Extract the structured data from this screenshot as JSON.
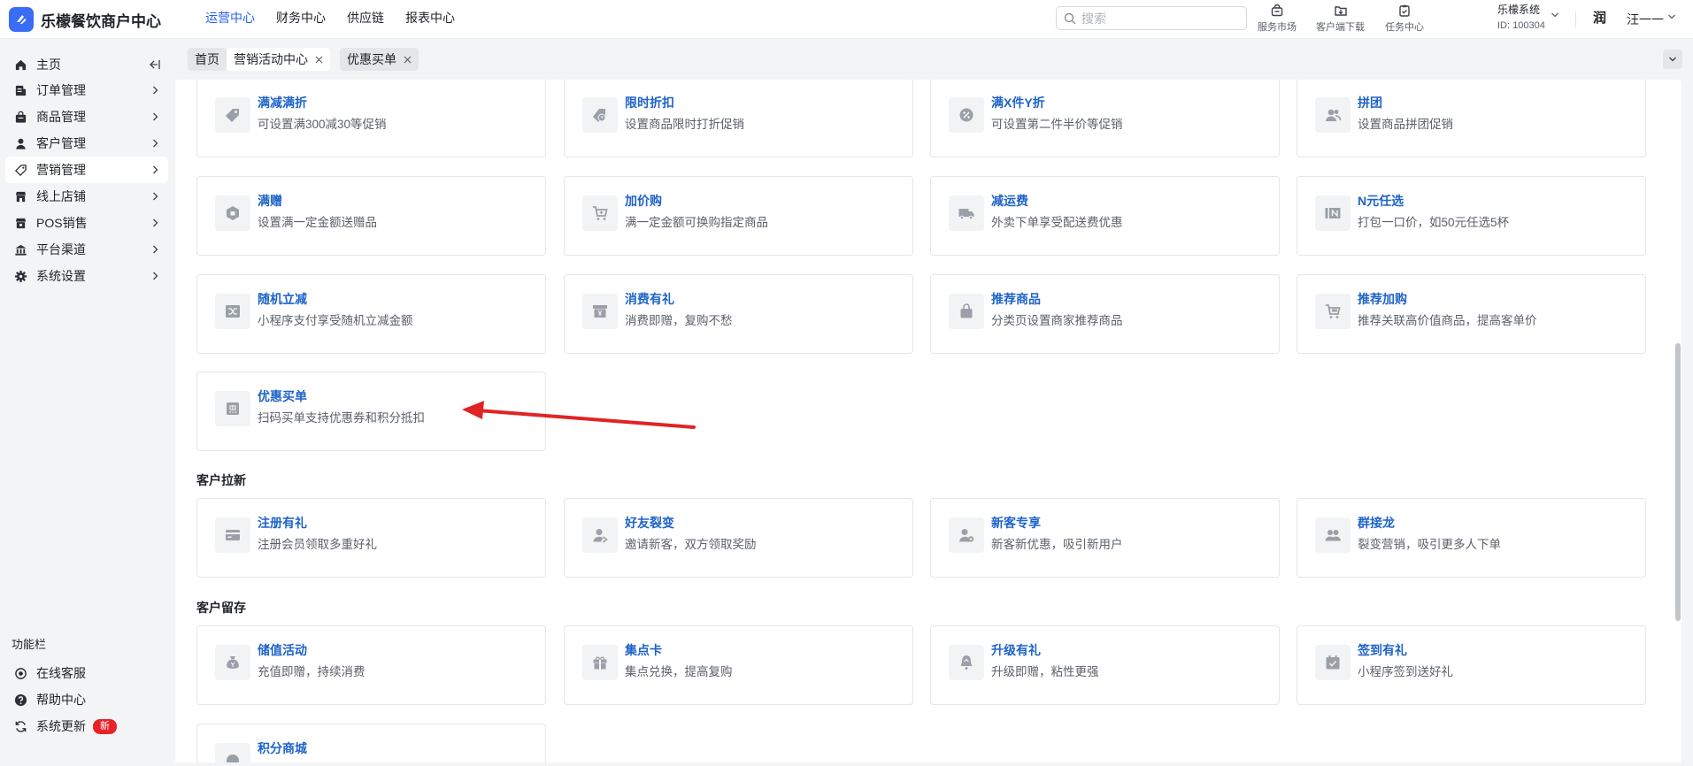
{
  "header": {
    "brand": "乐檬餐饮商户中心",
    "nav": [
      "运营中心",
      "财务中心",
      "供应链",
      "报表中心"
    ],
    "active_nav": 0,
    "search_placeholder": "搜索",
    "tools": [
      {
        "label": "服务市场",
        "icon": "store-icon"
      },
      {
        "label": "客户端下载",
        "icon": "download-folder-icon"
      },
      {
        "label": "任务中心",
        "icon": "clipboard-icon"
      }
    ],
    "system_name": "乐檬系统",
    "system_id": "ID: 100304",
    "avatar_text": "润",
    "user_name": "汪一一"
  },
  "sidebar": {
    "items": [
      {
        "label": "主页",
        "icon": "home-icon"
      },
      {
        "label": "订单管理",
        "icon": "order-icon"
      },
      {
        "label": "商品管理",
        "icon": "bag-icon"
      },
      {
        "label": "客户管理",
        "icon": "user-icon"
      },
      {
        "label": "营销管理",
        "icon": "tag-icon"
      },
      {
        "label": "线上店铺",
        "icon": "shop-icon"
      },
      {
        "label": "POS销售",
        "icon": "pos-icon"
      },
      {
        "label": "平台渠道",
        "icon": "bank-icon"
      },
      {
        "label": "系统设置",
        "icon": "gear-icon"
      }
    ],
    "active_index": 4,
    "section_label": "功能栏",
    "footer": [
      {
        "label": "在线客服",
        "icon": "headset-icon"
      },
      {
        "label": "帮助中心",
        "icon": "help-icon"
      },
      {
        "label": "系统更新",
        "icon": "refresh-icon",
        "badge": "新"
      }
    ]
  },
  "tabs": [
    {
      "label": "首页",
      "closable": false
    },
    {
      "label": "营销活动中心",
      "closable": true,
      "active": true
    },
    {
      "label": "优惠买单",
      "closable": true
    }
  ],
  "sections": [
    {
      "title": "",
      "cards": [
        {
          "title": "满减满折",
          "desc": "可设置满300减30等促销",
          "icon": "tag-icon"
        },
        {
          "title": "限时折扣",
          "desc": "设置商品限时打折促销",
          "icon": "clock-tag-icon"
        },
        {
          "title": "满X件Y折",
          "desc": "可设置第二件半价等促销",
          "icon": "percent-icon"
        },
        {
          "title": "拼团",
          "desc": "设置商品拼团促销",
          "icon": "group-icon"
        },
        {
          "title": "满赠",
          "desc": "设置满一定金额送赠品",
          "icon": "gift-box-icon"
        },
        {
          "title": "加价购",
          "desc": "满一定金额可换购指定商品",
          "icon": "cart-plus-icon"
        },
        {
          "title": "减运费",
          "desc": "外卖下单享受配送费优惠",
          "icon": "truck-icon"
        },
        {
          "title": "N元任选",
          "desc": "打包一口价，如50元任选5杯",
          "icon": "n-icon"
        },
        {
          "title": "随机立减",
          "desc": "小程序支付享受随机立减金额",
          "icon": "shuffle-icon"
        },
        {
          "title": "消费有礼",
          "desc": "消费即赠，复购不愁",
          "icon": "yen-box-icon"
        },
        {
          "title": "推荐商品",
          "desc": "分类页设置商家推荐商品",
          "icon": "bag-icon"
        },
        {
          "title": "推荐加购",
          "desc": "推荐关联高价值商品，提高客单价",
          "icon": "cart-icon"
        },
        {
          "title": "优惠买单",
          "desc": "扫码买单支持优惠券和积分抵扣",
          "icon": "hui-icon"
        }
      ]
    },
    {
      "title": "客户拉新",
      "cards": [
        {
          "title": "注册有礼",
          "desc": "注册会员领取多重好礼",
          "icon": "card-icon"
        },
        {
          "title": "好友裂变",
          "desc": "邀请新客，双方领取奖励",
          "icon": "user-share-icon"
        },
        {
          "title": "新客专享",
          "desc": "新客新优惠，吸引新用户",
          "icon": "user-new-icon"
        },
        {
          "title": "群接龙",
          "desc": "裂变营销，吸引更多人下单",
          "icon": "group-icon"
        }
      ]
    },
    {
      "title": "客户留存",
      "cards": [
        {
          "title": "储值活动",
          "desc": "充值即赠，持续消费",
          "icon": "money-bag-icon"
        },
        {
          "title": "集点卡",
          "desc": "集点兑换，提高复购",
          "icon": "gift-icon"
        },
        {
          "title": "升级有礼",
          "desc": "升级即赠，粘性更强",
          "icon": "bell-up-icon"
        },
        {
          "title": "签到有礼",
          "desc": "小程序签到送好礼",
          "icon": "calendar-check-icon"
        },
        {
          "title": "积分商城",
          "desc": "",
          "icon": "points-icon"
        }
      ]
    }
  ],
  "colors": {
    "accent": "#2563eb",
    "card_title": "#1e63c8",
    "annotation_arrow": "#e02424",
    "badge": "#e8222a"
  }
}
